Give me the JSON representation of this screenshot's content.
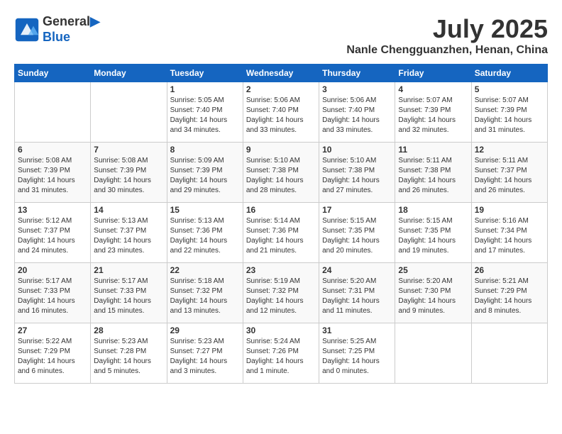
{
  "header": {
    "logo_line1": "General",
    "logo_line2": "Blue",
    "month": "July 2025",
    "location": "Nanle Chengguanzhen, Henan, China"
  },
  "days_of_week": [
    "Sunday",
    "Monday",
    "Tuesday",
    "Wednesday",
    "Thursday",
    "Friday",
    "Saturday"
  ],
  "weeks": [
    [
      {
        "day": "",
        "info": ""
      },
      {
        "day": "",
        "info": ""
      },
      {
        "day": "1",
        "info": "Sunrise: 5:05 AM\nSunset: 7:40 PM\nDaylight: 14 hours and 34 minutes."
      },
      {
        "day": "2",
        "info": "Sunrise: 5:06 AM\nSunset: 7:40 PM\nDaylight: 14 hours and 33 minutes."
      },
      {
        "day": "3",
        "info": "Sunrise: 5:06 AM\nSunset: 7:40 PM\nDaylight: 14 hours and 33 minutes."
      },
      {
        "day": "4",
        "info": "Sunrise: 5:07 AM\nSunset: 7:39 PM\nDaylight: 14 hours and 32 minutes."
      },
      {
        "day": "5",
        "info": "Sunrise: 5:07 AM\nSunset: 7:39 PM\nDaylight: 14 hours and 31 minutes."
      }
    ],
    [
      {
        "day": "6",
        "info": "Sunrise: 5:08 AM\nSunset: 7:39 PM\nDaylight: 14 hours and 31 minutes."
      },
      {
        "day": "7",
        "info": "Sunrise: 5:08 AM\nSunset: 7:39 PM\nDaylight: 14 hours and 30 minutes."
      },
      {
        "day": "8",
        "info": "Sunrise: 5:09 AM\nSunset: 7:39 PM\nDaylight: 14 hours and 29 minutes."
      },
      {
        "day": "9",
        "info": "Sunrise: 5:10 AM\nSunset: 7:38 PM\nDaylight: 14 hours and 28 minutes."
      },
      {
        "day": "10",
        "info": "Sunrise: 5:10 AM\nSunset: 7:38 PM\nDaylight: 14 hours and 27 minutes."
      },
      {
        "day": "11",
        "info": "Sunrise: 5:11 AM\nSunset: 7:38 PM\nDaylight: 14 hours and 26 minutes."
      },
      {
        "day": "12",
        "info": "Sunrise: 5:11 AM\nSunset: 7:37 PM\nDaylight: 14 hours and 26 minutes."
      }
    ],
    [
      {
        "day": "13",
        "info": "Sunrise: 5:12 AM\nSunset: 7:37 PM\nDaylight: 14 hours and 24 minutes."
      },
      {
        "day": "14",
        "info": "Sunrise: 5:13 AM\nSunset: 7:37 PM\nDaylight: 14 hours and 23 minutes."
      },
      {
        "day": "15",
        "info": "Sunrise: 5:13 AM\nSunset: 7:36 PM\nDaylight: 14 hours and 22 minutes."
      },
      {
        "day": "16",
        "info": "Sunrise: 5:14 AM\nSunset: 7:36 PM\nDaylight: 14 hours and 21 minutes."
      },
      {
        "day": "17",
        "info": "Sunrise: 5:15 AM\nSunset: 7:35 PM\nDaylight: 14 hours and 20 minutes."
      },
      {
        "day": "18",
        "info": "Sunrise: 5:15 AM\nSunset: 7:35 PM\nDaylight: 14 hours and 19 minutes."
      },
      {
        "day": "19",
        "info": "Sunrise: 5:16 AM\nSunset: 7:34 PM\nDaylight: 14 hours and 17 minutes."
      }
    ],
    [
      {
        "day": "20",
        "info": "Sunrise: 5:17 AM\nSunset: 7:33 PM\nDaylight: 14 hours and 16 minutes."
      },
      {
        "day": "21",
        "info": "Sunrise: 5:17 AM\nSunset: 7:33 PM\nDaylight: 14 hours and 15 minutes."
      },
      {
        "day": "22",
        "info": "Sunrise: 5:18 AM\nSunset: 7:32 PM\nDaylight: 14 hours and 13 minutes."
      },
      {
        "day": "23",
        "info": "Sunrise: 5:19 AM\nSunset: 7:32 PM\nDaylight: 14 hours and 12 minutes."
      },
      {
        "day": "24",
        "info": "Sunrise: 5:20 AM\nSunset: 7:31 PM\nDaylight: 14 hours and 11 minutes."
      },
      {
        "day": "25",
        "info": "Sunrise: 5:20 AM\nSunset: 7:30 PM\nDaylight: 14 hours and 9 minutes."
      },
      {
        "day": "26",
        "info": "Sunrise: 5:21 AM\nSunset: 7:29 PM\nDaylight: 14 hours and 8 minutes."
      }
    ],
    [
      {
        "day": "27",
        "info": "Sunrise: 5:22 AM\nSunset: 7:29 PM\nDaylight: 14 hours and 6 minutes."
      },
      {
        "day": "28",
        "info": "Sunrise: 5:23 AM\nSunset: 7:28 PM\nDaylight: 14 hours and 5 minutes."
      },
      {
        "day": "29",
        "info": "Sunrise: 5:23 AM\nSunset: 7:27 PM\nDaylight: 14 hours and 3 minutes."
      },
      {
        "day": "30",
        "info": "Sunrise: 5:24 AM\nSunset: 7:26 PM\nDaylight: 14 hours and 1 minute."
      },
      {
        "day": "31",
        "info": "Sunrise: 5:25 AM\nSunset: 7:25 PM\nDaylight: 14 hours and 0 minutes."
      },
      {
        "day": "",
        "info": ""
      },
      {
        "day": "",
        "info": ""
      }
    ]
  ]
}
